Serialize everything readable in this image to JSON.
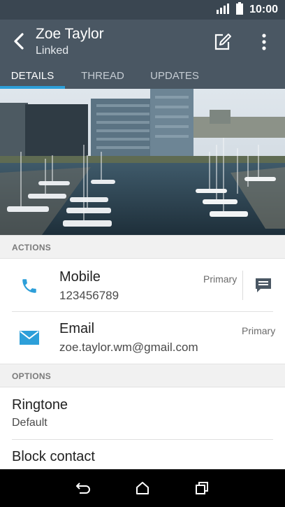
{
  "status_bar": {
    "time": "10:00",
    "icons": [
      "signal-icon",
      "battery-icon"
    ]
  },
  "header": {
    "name": "Zoe Taylor",
    "subtitle": "Linked",
    "icons": [
      "back-icon",
      "edit-icon",
      "more-vert-icon"
    ]
  },
  "tabs": [
    {
      "label": "DETAILS",
      "active": true
    },
    {
      "label": "THREAD",
      "active": false
    },
    {
      "label": "UPDATES",
      "active": false
    }
  ],
  "actions": {
    "header": "ACTIONS",
    "mobile": {
      "title": "Mobile",
      "value": "123456789",
      "tag": "Primary"
    },
    "email": {
      "title": "Email",
      "value": "zoe.taylor.wm@gmail.com",
      "tag": "Primary"
    }
  },
  "options": {
    "header": "OPTIONS",
    "ringtone": {
      "title": "Ringtone",
      "value": "Default"
    },
    "block": {
      "title": "Block contact"
    }
  },
  "colors": {
    "accent": "#2d9fd9",
    "app_bar": "#4a5763",
    "status_bar": "#3a4651"
  }
}
